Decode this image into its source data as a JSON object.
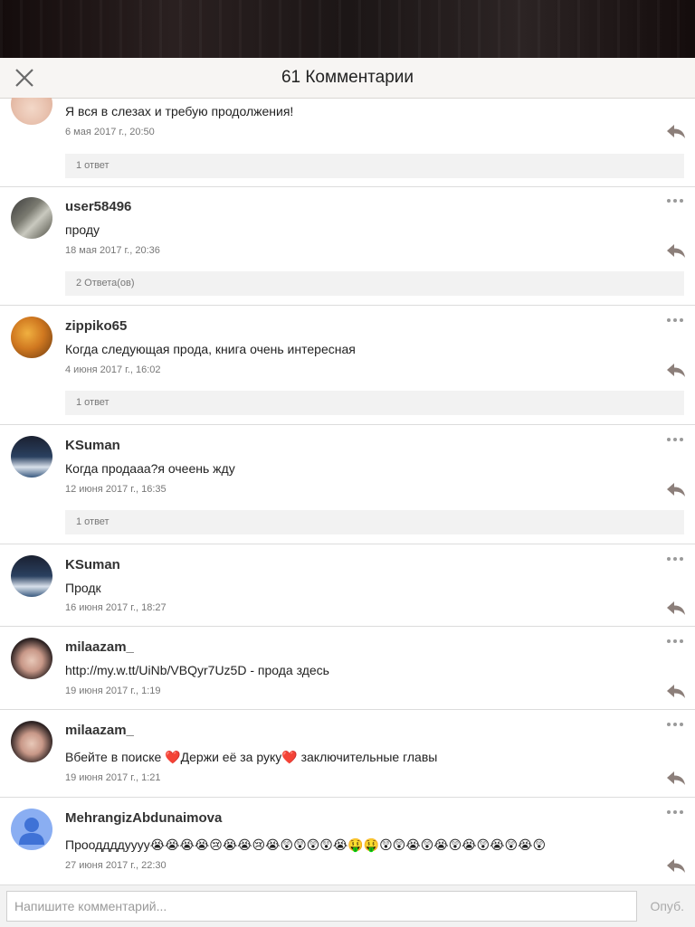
{
  "header": {
    "title": "61 Комментарии",
    "close_icon": "close-icon"
  },
  "comments": [
    {
      "username": "",
      "text": "Я вся в слезах и требую продолжения!",
      "date": "6 мая 2017 г., 20:50",
      "replies": "1 ответ"
    },
    {
      "username": "user58496",
      "text": "проду",
      "date": "18 мая 2017 г., 20:36",
      "replies": "2 Ответа(ов)"
    },
    {
      "username": "zippiko65",
      "text": "Когда следующая прода, книга очень интересная",
      "date": "4 июня 2017 г., 16:02",
      "replies": "1 ответ"
    },
    {
      "username": "KSuman",
      "text": "Когда продааа?я очеень жду",
      "date": "12 июня 2017 г., 16:35",
      "replies": "1 ответ"
    },
    {
      "username": "KSuman",
      "text": "Продк",
      "date": "16 июня 2017 г., 18:27"
    },
    {
      "username": "milaazam_",
      "text": "http://my.w.tt/UiNb/VBQyr7Uz5D - прода здесь",
      "date": "19 июня 2017 г., 1:19"
    },
    {
      "username": "milaazam_",
      "text_parts": [
        "Вбейте в поиске ",
        "❤️",
        "Держи её за руку",
        "❤️",
        " заключительные главы"
      ],
      "date": "19 июня 2017 г., 1:21"
    },
    {
      "username": "MehrangizAbdunaimova",
      "text": "Прооддддуууу😭😭😭😭😢😭😭😢😭😲😲😲😲😭🤑🤑😲😲😭😲😭😲😭😲😭😲😭😲",
      "date": "27 июня 2017 г., 22:30"
    }
  ],
  "footer": {
    "placeholder": "Напишите комментарий...",
    "publish_label": "Опуб."
  },
  "colors": {
    "header_bg": "#f7f5f3",
    "reply_icon": "#8c7f7a",
    "replies_bar": "#f2f2f2",
    "default_avatar": "#8aaef2"
  }
}
